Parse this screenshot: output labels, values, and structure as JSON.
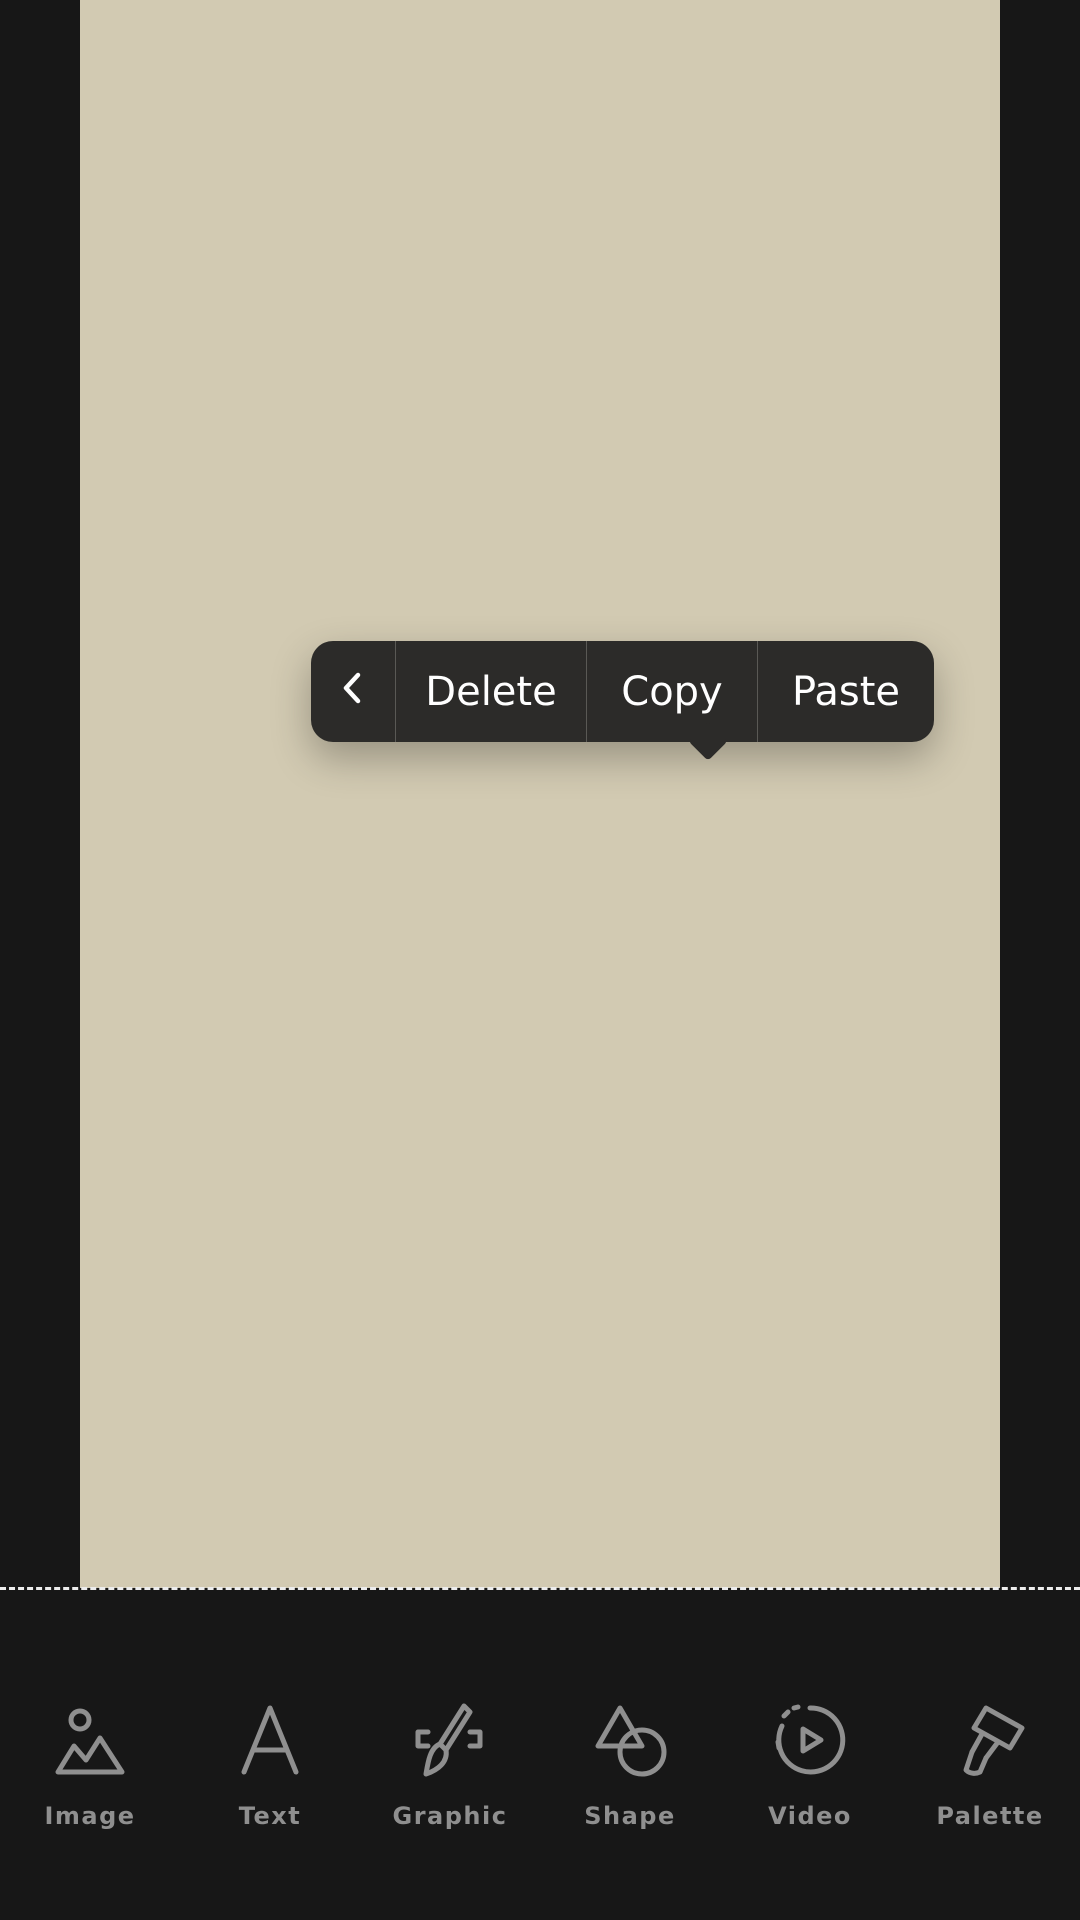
{
  "context_menu": {
    "back_label": "<",
    "items": [
      {
        "label": "Delete"
      },
      {
        "label": "Copy"
      },
      {
        "label": "Paste"
      }
    ]
  },
  "toolbar": {
    "tools": [
      {
        "label": "Image",
        "icon": "image-icon"
      },
      {
        "label": "Text",
        "icon": "text-icon"
      },
      {
        "label": "Graphic",
        "icon": "graphic-icon"
      },
      {
        "label": "Shape",
        "icon": "shape-icon"
      },
      {
        "label": "Video",
        "icon": "video-icon"
      },
      {
        "label": "Palette",
        "icon": "palette-icon"
      }
    ]
  },
  "colors": {
    "background": "#171717",
    "canvas": "#d2cab2",
    "menu": "#2c2b29",
    "toolbar_icon": "#8f8f8f"
  }
}
